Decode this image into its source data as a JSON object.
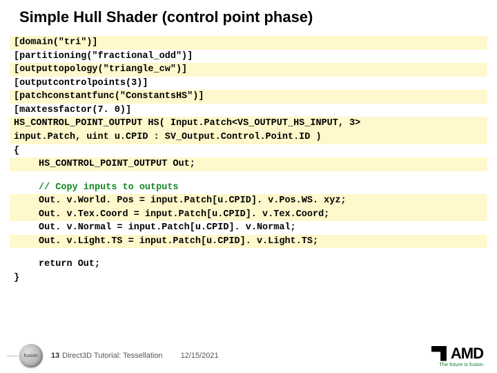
{
  "title": "Simple Hull Shader (control point phase)",
  "code": {
    "l1": "[domain(\"tri\")]",
    "l2": "[partitioning(\"fractional_odd\")]",
    "l3": "[outputtopology(\"triangle_cw\")]",
    "l4": "[outputcontrolpoints(3)]",
    "l5": "[patchconstantfunc(\"ConstantsHS\")]",
    "l6": "[maxtessfactor(7. 0)]",
    "l7": "HS_CONTROL_POINT_OUTPUT HS( Input.Patch<VS_OUTPUT_HS_INPUT, 3>",
    "l8": "input.Patch, uint u.CPID : SV_Output.Control.Point.ID )",
    "l9": "{",
    "l10": "HS_CONTROL_POINT_OUTPUT Out;",
    "l11": "// Copy inputs to outputs",
    "l12": "Out. v.World. Pos = input.Patch[u.CPID]. v.Pos.WS. xyz;",
    "l13": "Out. v.Tex.Coord = input.Patch[u.CPID]. v.Tex.Coord;",
    "l14": "Out. v.Normal = input.Patch[u.CPID]. v.Normal;",
    "l15": "Out. v.Light.TS = input.Patch[u.CPID]. v.Light.TS;",
    "l16": "return Out;",
    "l17": "}"
  },
  "footer": {
    "page": "13",
    "text": "Direct3D Tutorial: Tessellation",
    "date": "12/15/2021",
    "badge": "fusion",
    "logo_word": "AMD",
    "logo_tag": "The future is fusion"
  }
}
